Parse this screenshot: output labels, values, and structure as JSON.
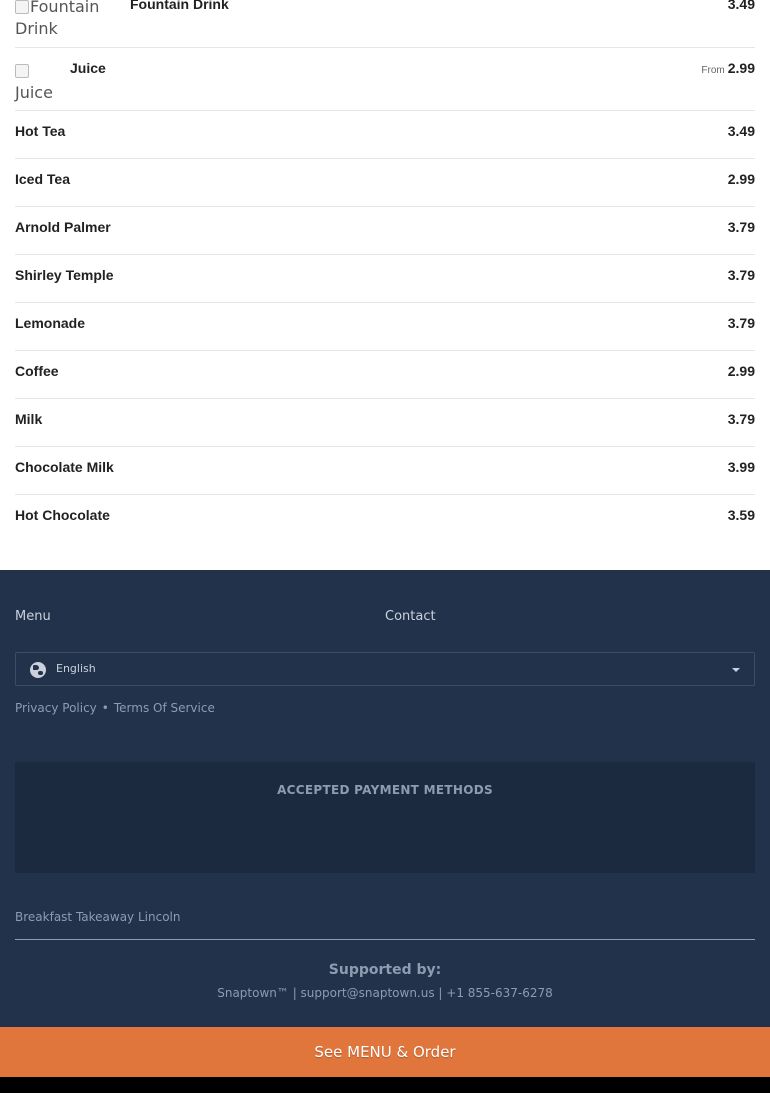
{
  "menu": {
    "fountain": {
      "alt": "Fountain Drink",
      "name": "Fountain Drink",
      "price": "3.49"
    },
    "juice": {
      "alt": "Juice",
      "name": "Juice",
      "from_label": "From",
      "price": "2.99"
    },
    "items": [
      {
        "name": "Hot Tea",
        "price": "3.49"
      },
      {
        "name": "Iced Tea",
        "price": "2.99"
      },
      {
        "name": "Arnold Palmer",
        "price": "3.79"
      },
      {
        "name": "Shirley Temple",
        "price": "3.79"
      },
      {
        "name": "Lemonade",
        "price": "3.79"
      },
      {
        "name": "Coffee",
        "price": "2.99"
      },
      {
        "name": "Milk",
        "price": "3.79"
      },
      {
        "name": "Chocolate Milk",
        "price": "3.99"
      },
      {
        "name": "Hot Chocolate",
        "price": "3.59"
      }
    ]
  },
  "footer": {
    "menu_link": "Menu",
    "contact_link": "Contact",
    "language": {
      "selected": "English",
      "icon": "globe-icon"
    },
    "privacy_link": "Privacy Policy",
    "separator": "•",
    "terms_link": "Terms Of Service",
    "payment_title": "ACCEPTED PAYMENT METHODS",
    "business_name": "Breakfast Takeaway Lincoln",
    "supported_by": "Supported by:",
    "support_line": "Snaptown™ | support@snaptown.us | +1 855-637-6278"
  },
  "order_button": {
    "label": "See MENU & Order"
  },
  "colors": {
    "footer_bg": "#22324a",
    "accent": "#e0763c",
    "muted_text": "#8e9bb0"
  }
}
